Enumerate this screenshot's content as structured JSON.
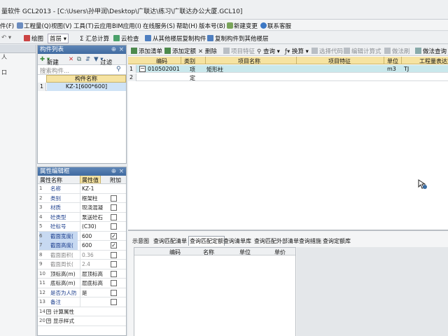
{
  "window": {
    "title": "量软件 GCL2013 - [C:\\Users\\孙甲润\\Desktop\\广联达\\练习\\广联达办公大厦.GCL10]"
  },
  "menu": {
    "items": [
      {
        "label": "件(F)"
      },
      {
        "label": "工程量(Q)"
      },
      {
        "label": "视图(V)"
      },
      {
        "label": "工具(T)"
      },
      {
        "label": "云应用"
      },
      {
        "label": "BIM应用(I)"
      },
      {
        "label": "在线服务(S)"
      },
      {
        "label": "帮助(H)"
      },
      {
        "label": "版本号(B)"
      },
      {
        "label": "新建变更"
      },
      {
        "label": "联系客服"
      }
    ]
  },
  "toolbar": {
    "draw": "绘图",
    "layer": "首层",
    "sum": "Σ 汇总计算",
    "cloud_check": "云检查",
    "copy_from": "从其他楼层复制构件",
    "copy_to": "复制构件到其他楼层"
  },
  "tree": {
    "rows": [
      "人",
      "",
      "口",
      ""
    ]
  },
  "component_list": {
    "title": "构件列表",
    "new": "新建",
    "filter": "过滤",
    "search_placeholder": "搜索构件...",
    "column_header": "构件名称",
    "rows": [
      {
        "num": "1",
        "name": "KZ-1[600*600]"
      }
    ]
  },
  "properties": {
    "title": "属性编辑框",
    "headers": {
      "name": "属性名称",
      "value": "属性值",
      "extra": "附加"
    },
    "rows": [
      {
        "num": "1",
        "name": "名称",
        "value": "KZ-1",
        "check": false,
        "has_check": false,
        "style": "blue"
      },
      {
        "num": "2",
        "name": "类别",
        "value": "框架柱",
        "check": false,
        "has_check": true,
        "style": "blue"
      },
      {
        "num": "3",
        "name": "材质",
        "value": "现浇混凝",
        "check": false,
        "has_check": true,
        "style": "blue"
      },
      {
        "num": "4",
        "name": "砼类型",
        "value": "泵送砼石",
        "check": false,
        "has_check": true,
        "style": "blue"
      },
      {
        "num": "5",
        "name": "砼标号",
        "value": "(C30)",
        "check": false,
        "has_check": true,
        "style": "blue"
      },
      {
        "num": "6",
        "name": "截面宽度(",
        "value": "600",
        "check": true,
        "has_check": true,
        "style": "blue-hl"
      },
      {
        "num": "7",
        "name": "截面高度(",
        "value": "600",
        "check": true,
        "has_check": true,
        "style": "blue-hl"
      },
      {
        "num": "8",
        "name": "截面面积(",
        "value": "0.36",
        "check": false,
        "has_check": true,
        "style": "gray"
      },
      {
        "num": "9",
        "name": "截面周长(",
        "value": "2.4",
        "check": false,
        "has_check": true,
        "style": "gray"
      },
      {
        "num": "10",
        "name": "顶标高(m)",
        "value": "层顶标高",
        "check": false,
        "has_check": true,
        "style": "black"
      },
      {
        "num": "11",
        "name": "底标高(m)",
        "value": "层底标高",
        "check": false,
        "has_check": true,
        "style": "black"
      },
      {
        "num": "12",
        "name": "是否为人防",
        "value": "是",
        "check": false,
        "has_check": true,
        "style": "blue"
      },
      {
        "num": "13",
        "name": "备注",
        "value": "",
        "check": false,
        "has_check": true,
        "style": "blue"
      },
      {
        "num": "14",
        "name": "计算属性",
        "value": "",
        "check": false,
        "has_check": false,
        "style": "group"
      },
      {
        "num": "20",
        "name": "显示样式",
        "value": "",
        "check": false,
        "has_check": false,
        "style": "group"
      }
    ]
  },
  "main_toolbar": {
    "add_list": "添加清单",
    "add_quota": "添加定额",
    "delete": "删除",
    "item_feature": "项目特征",
    "query": "查询",
    "convert": "换算",
    "select_code": "选择代码",
    "edit_formula": "编辑计算式",
    "do_method": "做法刷",
    "method_query": "做法查询"
  },
  "main_grid": {
    "headers": [
      "编码",
      "类别",
      "项目名称",
      "项目特征",
      "单位",
      "工程量表达式"
    ],
    "rows": [
      {
        "num": "1",
        "code": "010502001",
        "type": "项",
        "name": "矩形柱",
        "feature": "",
        "unit": "m3",
        "expr": "TJ"
      },
      {
        "num": "2",
        "code": "",
        "type": "定",
        "name": "",
        "feature": "",
        "unit": "",
        "expr": ""
      }
    ]
  },
  "lower_panel": {
    "tabs": [
      "示意图",
      "查询匹配清单",
      "查询匹配定额",
      "查询清单库",
      "查询匹配外部清单",
      "查询措施",
      "查询定额库"
    ],
    "active_tab": 2,
    "headers": [
      "编码",
      "名称",
      "单位",
      "单价"
    ]
  }
}
